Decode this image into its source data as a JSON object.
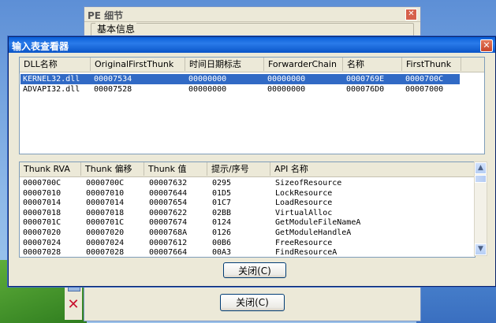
{
  "pe_window": {
    "title": "PE 细节",
    "group_label": "基本信息",
    "close_button": "关闭(C)"
  },
  "viewer": {
    "title": "输入表查看器",
    "close_button": "关闭(C)"
  },
  "dll_table": {
    "columns": [
      "DLL名称",
      "OriginalFirstThunk",
      "时间日期标志",
      "ForwarderChain",
      "名称",
      "FirstThunk"
    ],
    "rows": [
      [
        "KERNEL32.dll",
        "00007534",
        "00000000",
        "00000000",
        "0000769E",
        "0000700C"
      ],
      [
        "ADVAPI32.dll",
        "00007528",
        "00000000",
        "00000000",
        "000076D0",
        "00007000"
      ]
    ],
    "selected_index": 0
  },
  "thunk_table": {
    "columns": [
      "Thunk RVA",
      "Thunk 偏移",
      "Thunk 值",
      "提示/序号",
      "API 名称"
    ],
    "rows": [
      [
        "0000700C",
        "0000700C",
        "00007632",
        "0295",
        "SizeofResource"
      ],
      [
        "00007010",
        "00007010",
        "00007644",
        "01D5",
        "LockResource"
      ],
      [
        "00007014",
        "00007014",
        "00007654",
        "01C7",
        "LoadResource"
      ],
      [
        "00007018",
        "00007018",
        "00007622",
        "02BB",
        "VirtualAlloc"
      ],
      [
        "0000701C",
        "0000701C",
        "00007674",
        "0124",
        "GetModuleFileNameA"
      ],
      [
        "00007020",
        "00007020",
        "0000768A",
        "0126",
        "GetModuleHandleA"
      ],
      [
        "00007024",
        "00007024",
        "00007612",
        "00B6",
        "FreeResource"
      ],
      [
        "00007028",
        "00007028",
        "00007664",
        "00A3",
        "FindResourceA"
      ]
    ]
  },
  "colors": {
    "title_bar": "#0a5fd8",
    "selection": "#316ac5",
    "window_bg": "#ece9d8"
  }
}
